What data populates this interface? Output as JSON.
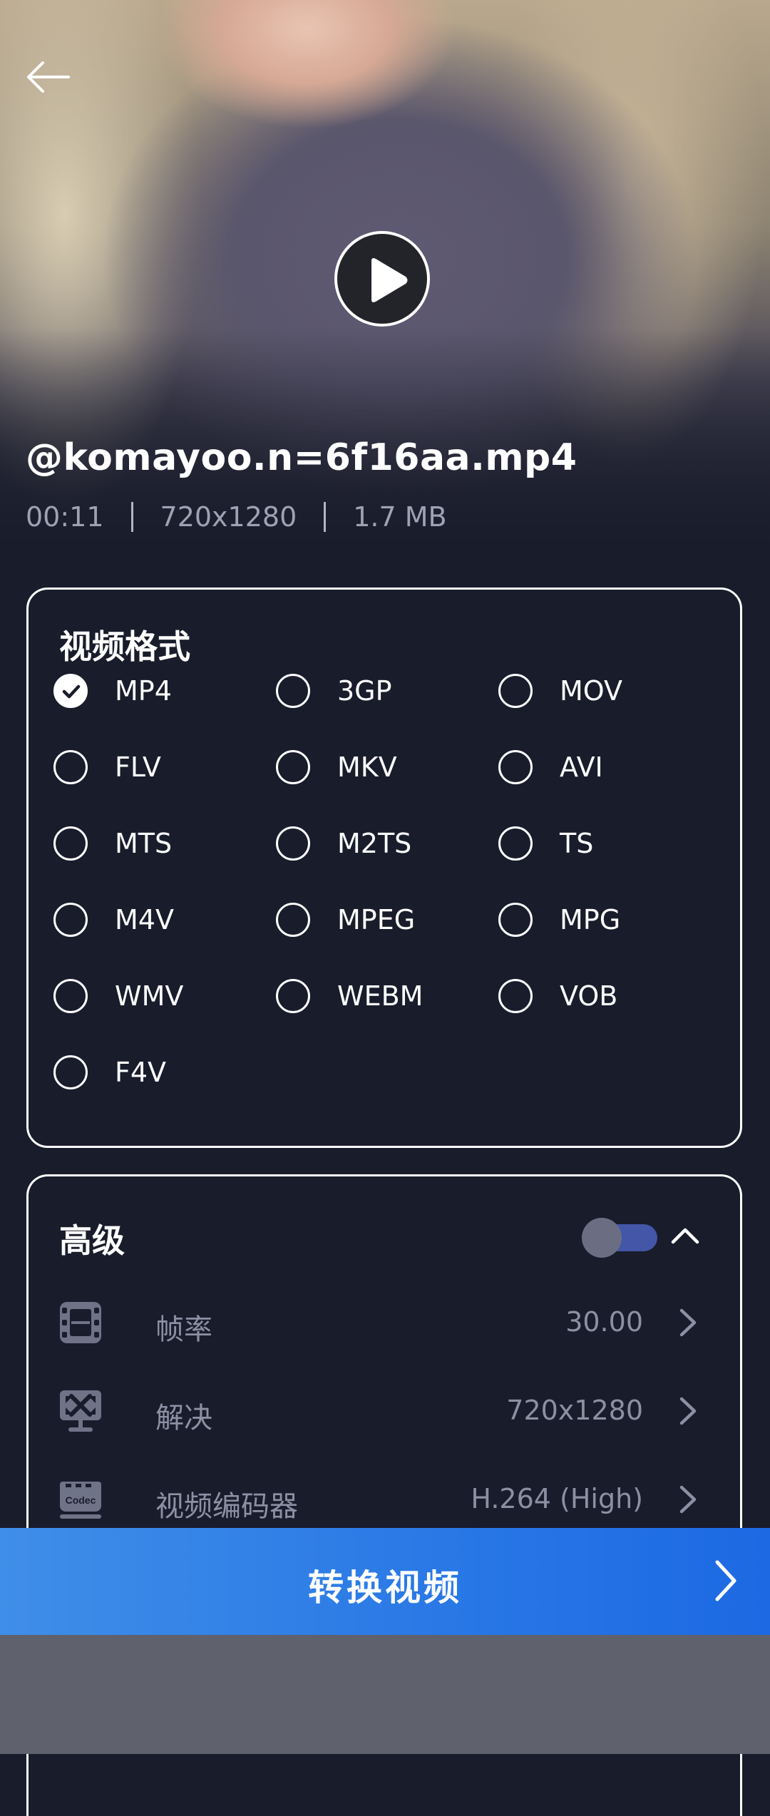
{
  "video": {
    "file_name": "@komayoo.n=6f16aa.mp4",
    "duration": "00:11",
    "resolution": "720x1280",
    "size": "1.7 MB"
  },
  "format_section": {
    "title": "视频格式",
    "selected": "MP4",
    "options": [
      "MP4",
      "3GP",
      "MOV",
      "FLV",
      "MKV",
      "AVI",
      "MTS",
      "M2TS",
      "TS",
      "M4V",
      "MPEG",
      "MPG",
      "WMV",
      "WEBM",
      "VOB",
      "F4V"
    ]
  },
  "advanced_section": {
    "title": "高级",
    "toggle_on": false,
    "rows": [
      {
        "icon": "film-icon",
        "label": "帧率",
        "value": "30.00"
      },
      {
        "icon": "resolution-icon",
        "label": "解决",
        "value": "720x1280"
      },
      {
        "icon": "codec-icon",
        "label": "视频编码器",
        "value": "H.264 (High)",
        "icon_text": "Codec"
      }
    ]
  },
  "convert_button": {
    "label": "转换视频"
  },
  "colors": {
    "background": "#191c2b",
    "accent_blue": "#2a79e6",
    "muted_text": "#8c90a3",
    "toggle_track": "#4456a8"
  }
}
